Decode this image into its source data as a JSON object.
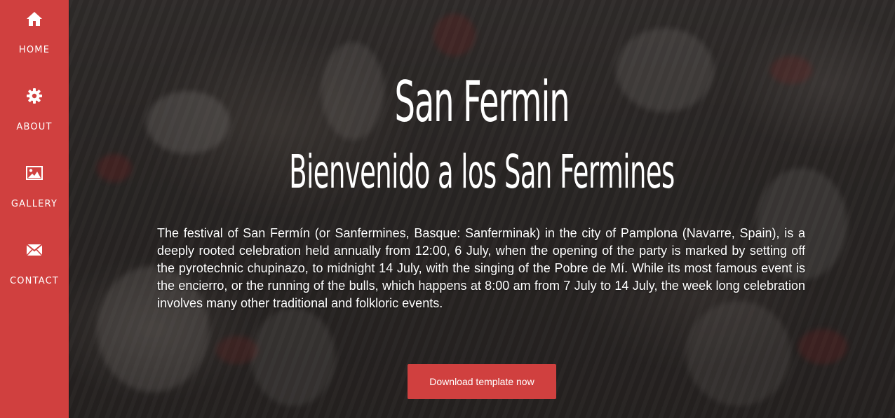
{
  "sidebar": {
    "items": [
      {
        "label": "HOME",
        "icon": "home-icon"
      },
      {
        "label": "ABOUT",
        "icon": "gear-icon"
      },
      {
        "label": "GALLERY",
        "icon": "image-icon"
      },
      {
        "label": "CONTACT",
        "icon": "envelope-icon"
      }
    ]
  },
  "hero": {
    "title": "San Fermin",
    "subtitle": "Bienvenido a los San Fermines",
    "description": "The festival of San Fermín (or Sanfermines, Basque: Sanferminak) in the city of Pamplona (Navarre, Spain), is a deeply rooted celebration held annually from 12:00, 6 July, when the opening of the party is marked by setting off the pyrotechnic chupinazo, to midnight 14 July, with the singing of the Pobre de Mí. While its most famous event is the encierro, or the running of the bulls, which happens at 8:00 am from 7 July to 14 July, the week long celebration involves many other traditional and folkloric events.",
    "cta_label": "Download template now"
  },
  "colors": {
    "accent": "#d0403f",
    "text": "#ffffff"
  }
}
